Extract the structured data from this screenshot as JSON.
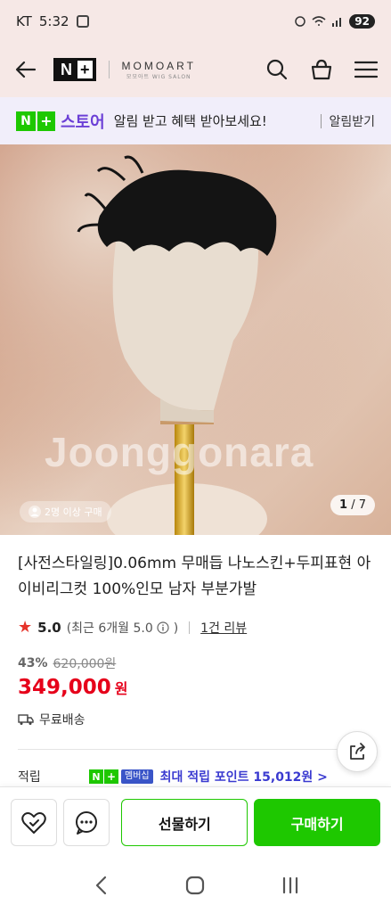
{
  "status": {
    "carrier": "KT",
    "time": "5:32",
    "battery": "92"
  },
  "header": {
    "logo_n": "N",
    "logo_plus": "+",
    "brand_name": "MOMOART",
    "brand_sub": "모모아트 WIG SALON"
  },
  "banner": {
    "logo_n": "N",
    "logo_plus": "+",
    "store_label": "스토어",
    "message": "알림 받고 혜택 받아보세요!",
    "action": "알림받기"
  },
  "image": {
    "watermark": "Joonggonara",
    "badge": "2명 이상 구매",
    "counter_current": "1",
    "counter_total": "/ 7"
  },
  "product": {
    "title": "[사전스타일링]0.06mm 무매듭 나노스킨+두피표현 아이비리그컷 100%인모 남자 부분가발",
    "rating": "5.0",
    "rating_recent": "(최근 6개월 5.0",
    "rating_recent_end": ")",
    "review_link": "1건 리뷰",
    "discount_rate": "43%",
    "original_price": "620,000원",
    "price": "349,000",
    "price_unit": "원",
    "shipping": "무료배송"
  },
  "points": {
    "label": "적립",
    "badge_n": "N",
    "badge_plus": "+",
    "badge_member": "멤버십",
    "text": "최대 적립 포인트 15,012원 >"
  },
  "actions": {
    "gift": "선물하기",
    "buy": "구매하기"
  },
  "colors": {
    "naver_green": "#1ec800",
    "price_red": "#e6001a",
    "store_purple": "#6b3fd6"
  }
}
